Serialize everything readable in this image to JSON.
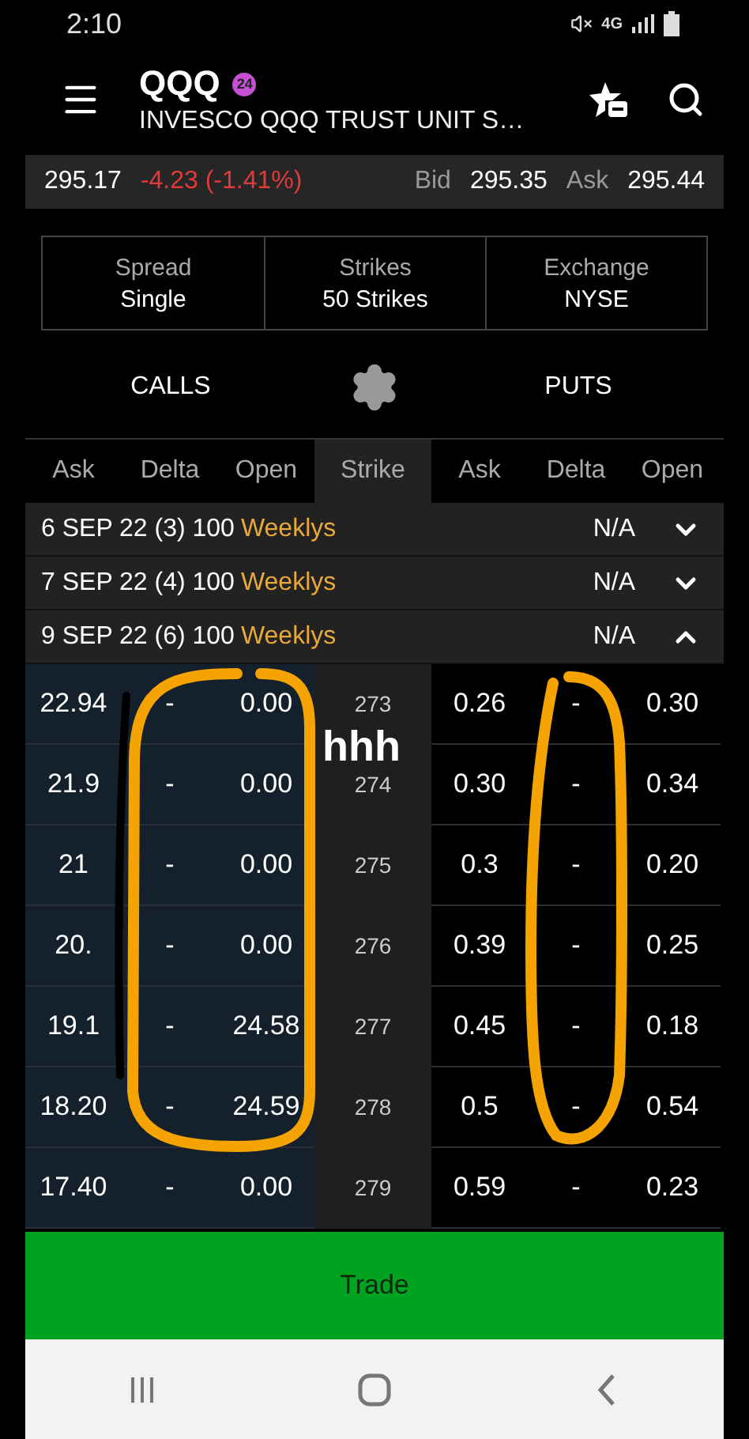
{
  "status_bar": {
    "time": "2:10",
    "network": "4G"
  },
  "header": {
    "symbol": "QQQ",
    "badge": "24",
    "name": "INVESCO QQQ TRUST UNIT S…"
  },
  "quote": {
    "last": "295.17",
    "change": "-4.23 (-1.41%)",
    "bid_label": "Bid",
    "bid": "295.35",
    "ask_label": "Ask",
    "ask": "295.44"
  },
  "settings": [
    {
      "label": "Spread",
      "value": "Single"
    },
    {
      "label": "Strikes",
      "value": "50 Strikes"
    },
    {
      "label": "Exchange",
      "value": "NYSE"
    }
  ],
  "sides": {
    "calls": "CALLS",
    "puts": "PUTS"
  },
  "columns": [
    {
      "label": "Ask",
      "kind": "side"
    },
    {
      "label": "Delta",
      "kind": "side"
    },
    {
      "label": "Open",
      "kind": "side"
    },
    {
      "label": "Strike",
      "kind": "strike"
    },
    {
      "label": "Ask",
      "kind": "side"
    },
    {
      "label": "Delta",
      "kind": "side"
    },
    {
      "label": "Open",
      "kind": "side"
    }
  ],
  "expirations": [
    {
      "date": "6 SEP 22 (3) 100",
      "series": "Weeklys",
      "price": "N/A",
      "expanded": false
    },
    {
      "date": "7 SEP 22 (4) 100",
      "series": "Weeklys",
      "price": "N/A",
      "expanded": false
    },
    {
      "date": "9 SEP 22 (6) 100",
      "series": "Weeklys",
      "price": "N/A",
      "expanded": true
    }
  ],
  "rows": [
    {
      "cells": [
        "22.94",
        "-",
        "0.00",
        "273",
        "0.26",
        "-",
        "0.30"
      ]
    },
    {
      "cells": [
        "21.9",
        "-",
        "0.00",
        "274",
        "0.30",
        "-",
        "0.34"
      ]
    },
    {
      "cells": [
        "21",
        "-",
        "0.00",
        "275",
        "0.3",
        "-",
        "0.20"
      ]
    },
    {
      "cells": [
        "20.",
        "-",
        "0.00",
        "276",
        "0.39",
        "-",
        "0.25"
      ]
    },
    {
      "cells": [
        "19.1",
        "-",
        "24.58",
        "277",
        "0.45",
        "-",
        "0.18"
      ]
    },
    {
      "cells": [
        "18.20",
        "-",
        "24.59",
        "278",
        "0.5",
        "-",
        "0.54"
      ]
    },
    {
      "cells": [
        "17.40",
        "-",
        "0.00",
        "279",
        "0.59",
        "-",
        "0.23"
      ]
    }
  ],
  "trade_button": "Trade",
  "annotations": [
    {
      "kind": "scribble"
    },
    {
      "kind": "left_loop"
    },
    {
      "kind": "right_loop"
    },
    {
      "kind": "text",
      "text": "hhh"
    }
  ]
}
